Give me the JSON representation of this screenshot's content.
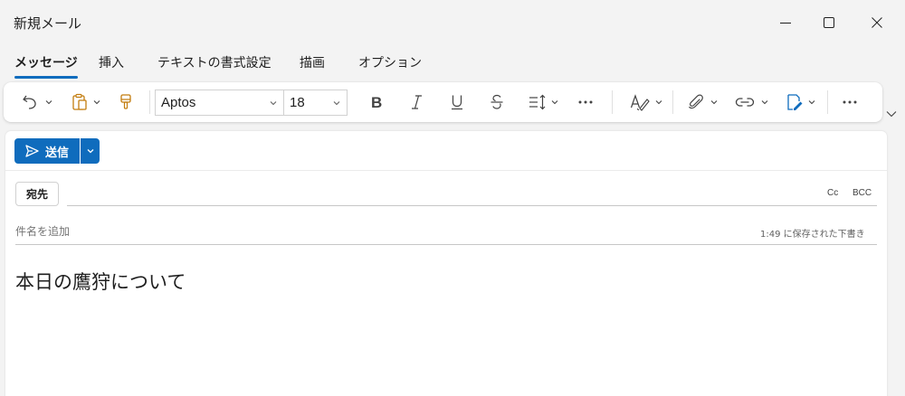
{
  "window": {
    "title": "新規メール",
    "minimize_icon": "minimize-icon",
    "maximize_icon": "maximize-icon",
    "close_icon": "close-icon"
  },
  "tabs": [
    {
      "label": "メッセージ",
      "active": true
    },
    {
      "label": "挿入",
      "active": false
    },
    {
      "label": "テキストの書式設定",
      "active": false
    },
    {
      "label": "描画",
      "active": false
    },
    {
      "label": "オプション",
      "active": false
    }
  ],
  "ribbon": {
    "font_family": "Aptos",
    "font_size": "18",
    "icons": [
      "undo-icon",
      "paste-icon",
      "format-painter-icon",
      "bold-icon",
      "italic-icon",
      "underline-icon",
      "strikethrough-icon",
      "line-spacing-icon",
      "more-icon",
      "editor-icon",
      "attach-icon",
      "link-icon",
      "signature-icon",
      "more-icon"
    ]
  },
  "compose": {
    "send_label": "送信",
    "to_label": "宛先",
    "cc_label": "Cc",
    "bcc_label": "BCC",
    "subject_placeholder": "件名を追加",
    "saved_status": "1:49 に保存された下書き",
    "body_text": "本日の鷹狩について"
  },
  "colors": {
    "accent": "#0f6cbd",
    "background": "#f3f3f3",
    "surface": "#ffffff"
  }
}
